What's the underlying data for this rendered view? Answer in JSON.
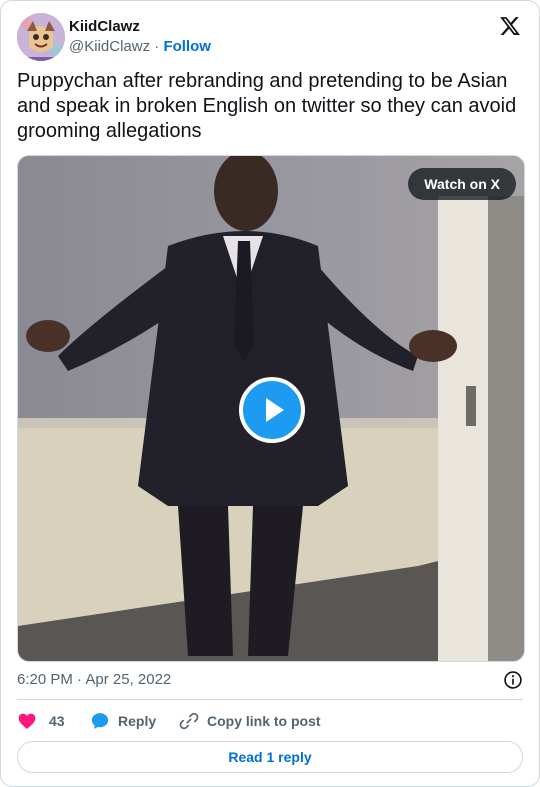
{
  "author": {
    "display_name": "KiidClawz",
    "handle": "@KiidClawz",
    "separator": "·",
    "follow_label": "Follow",
    "avatar_icon": "cartoon-avatar"
  },
  "logo_icon": "x-logo",
  "tweet": {
    "text": "Puppychan after rebranding and pretending to be Asian and speak in broken English on twitter so they can avoid grooming allegations"
  },
  "media": {
    "type": "video",
    "watch_label": "Watch on X",
    "play_icon": "play-icon",
    "accent_color": "#1d9bf0"
  },
  "meta": {
    "timestamp": "6:20 PM · Apr 25, 2022",
    "info_icon": "info-icon"
  },
  "actions": {
    "like_count": "43",
    "reply_label": "Reply",
    "copy_label": "Copy link to post",
    "like_color": "#f91880",
    "reply_color": "#1d9bf0"
  },
  "footer": {
    "read_replies_label": "Read 1 reply"
  }
}
